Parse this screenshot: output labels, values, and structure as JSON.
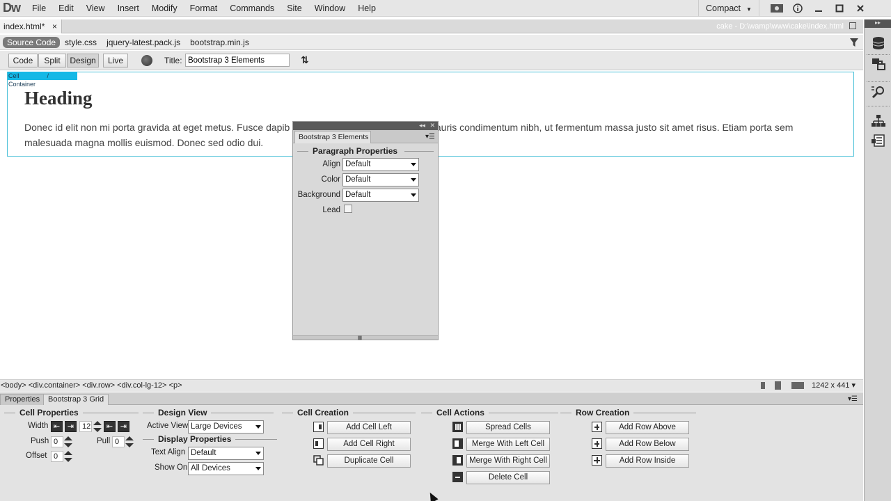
{
  "app": {
    "logo": "Dw",
    "menu": [
      "File",
      "Edit",
      "View",
      "Insert",
      "Modify",
      "Format",
      "Commands",
      "Site",
      "Window",
      "Help"
    ],
    "workspace": "Compact"
  },
  "document": {
    "tab": "index.html*",
    "tab_close": "×",
    "path": "cake - D:\\wamp\\www\\cake\\index.html"
  },
  "related_files": [
    "Source Code",
    "style.css",
    "jquery-latest.pack.js",
    "bootstrap.min.js"
  ],
  "toolbar": {
    "views": [
      "Code",
      "Split",
      "Design",
      "Live"
    ],
    "active_view": "Design",
    "title_label": "Title:",
    "title_value": "Bootstrap 3 Elements"
  },
  "design": {
    "cell_tag": "Cell",
    "container_tag": "/ Container",
    "heading": "Heading",
    "paragraph_left": "Donec id elit non mi porta gravida at eget metus. Fusce dapib",
    "paragraph_right": "rtor mauris condimentum nibh, ut fermentum massa justo sit amet risus. Etiam porta sem",
    "paragraph_line2": "malesuada magna mollis euismod. Donec sed odio dui."
  },
  "float_panel": {
    "tab": "Bootstrap 3 Elements",
    "section": "Paragraph Properties",
    "fields": [
      {
        "label": "Align",
        "value": "Default"
      },
      {
        "label": "Color",
        "value": "Default"
      },
      {
        "label": "Background",
        "value": "Default"
      }
    ],
    "lead_label": "Lead",
    "lead_checked": false
  },
  "status": {
    "tags": "<body> <div.container> <div.row> <div.col-lg-12> <p>",
    "window_size": "1242 x 441"
  },
  "bottom_panel": {
    "tabs": [
      "Properties",
      "Bootstrap 3 Grid"
    ],
    "active_tab": "Bootstrap 3 Grid",
    "cell_properties": {
      "title": "Cell Properties",
      "width_label": "Width",
      "width_value": "12",
      "push_label": "Push",
      "push_value": "0",
      "pull_label": "Pull",
      "pull_value": "0",
      "offset_label": "Offset",
      "offset_value": "0"
    },
    "design_view": {
      "title": "Design View",
      "active_view_label": "Active View",
      "active_view_value": "Large Devices"
    },
    "display_properties": {
      "title": "Display Properties",
      "text_align_label": "Text Align",
      "text_align_value": "Default",
      "show_on_label": "Show On",
      "show_on_value": "All Devices"
    },
    "cell_creation": {
      "title": "Cell Creation",
      "buttons": [
        "Add Cell Left",
        "Add Cell Right",
        "Duplicate Cell"
      ]
    },
    "cell_actions": {
      "title": "Cell Actions",
      "buttons": [
        "Spread Cells",
        "Merge With Left Cell",
        "Merge With Right Cell",
        "Delete Cell"
      ]
    },
    "row_creation": {
      "title": "Row Creation",
      "buttons": [
        "Add Row Above",
        "Add Row Below",
        "Add Row Inside"
      ]
    }
  },
  "colors": {
    "accent_cyan": "#14b8e6",
    "container_border": "#49c0d8",
    "chrome": "#e6e6e6"
  }
}
